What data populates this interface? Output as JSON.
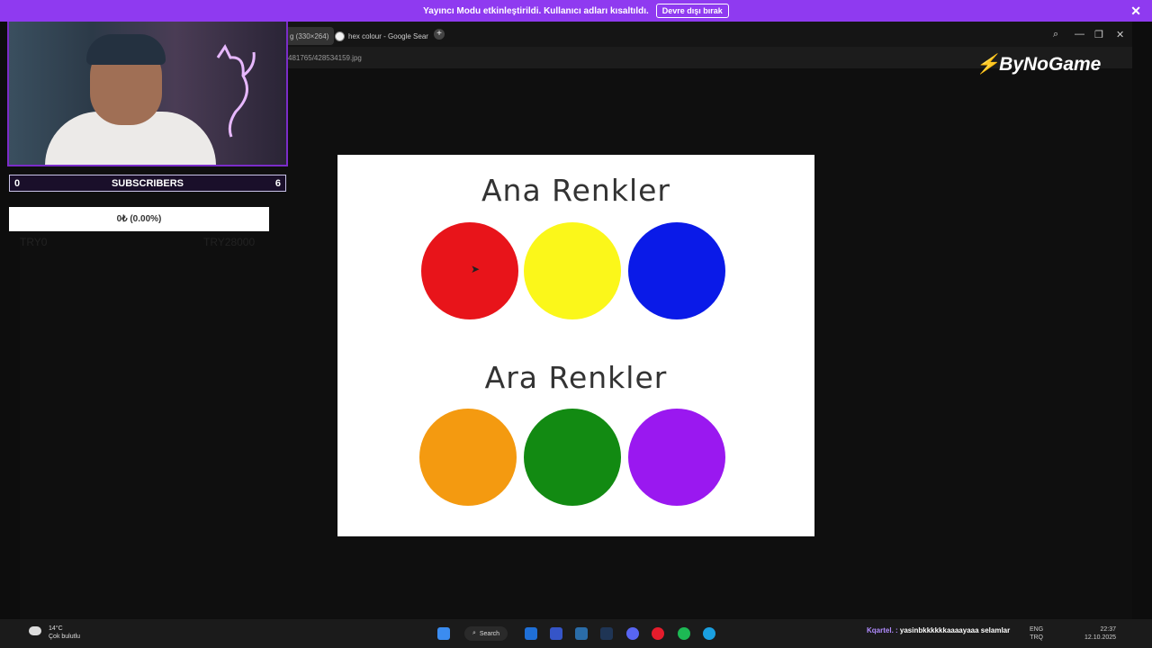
{
  "banner": {
    "message": "Yayıncı Modu etkinleştirildi. Kullanıcı adları kısaltıldı.",
    "button": "Devre dışı bırak",
    "close": "✕"
  },
  "browser": {
    "tabs": [
      {
        "label": "g (330×264)"
      },
      {
        "label": "hex colour - Google Sear"
      }
    ],
    "new_tab": "+",
    "address": "481765/428534159.jpg",
    "window": {
      "search": "⌕",
      "minimize": "—",
      "restore": "❐",
      "close": "✕"
    }
  },
  "image": {
    "title_primary": "Ana Renkler",
    "title_secondary": "Ara Renkler",
    "primary_colors": [
      "#e8141a",
      "#fbf71a",
      "#0a1ae8"
    ],
    "secondary_colors": [
      "#f49a10",
      "#128a12",
      "#9a18f0"
    ]
  },
  "overlay": {
    "subs_left": "0",
    "subs_label": "SUBSCRIBERS",
    "subs_right": "6",
    "goal": "0₺ (0.00%)",
    "goal_left_faint": "TRY0",
    "goal_right_faint": "TRY28000",
    "logo": "ByNoGame"
  },
  "taskbar": {
    "temp": "14°C",
    "weather": "Çok bulutlu",
    "search": "Search",
    "chat_user": "Kqartel. :",
    "chat_msg": "yasinbkkkkkkaaaayaaa selamlar",
    "lang_top": "ENG",
    "lang_bottom": "TRQ",
    "time": "22:37",
    "date": "12.10.2025"
  }
}
